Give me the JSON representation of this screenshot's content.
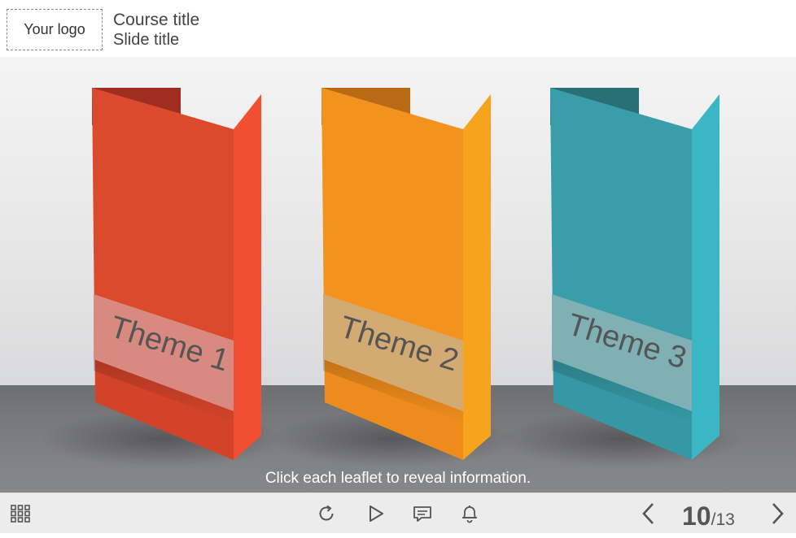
{
  "header": {
    "logo_text": "Your logo",
    "course_title": "Course title",
    "slide_title": "Slide title"
  },
  "leaflets": [
    {
      "label": "Theme 1",
      "color": "#dc4a2e"
    },
    {
      "label": "Theme 2",
      "color": "#f3931f"
    },
    {
      "label": "Theme 3",
      "color": "#3a9eaa"
    }
  ],
  "hint_text": "Click each leaflet to reveal information.",
  "toolbar": {
    "menu_icon": "grid-icon",
    "replay_icon": "replay-icon",
    "play_icon": "play-icon",
    "notes_icon": "comment-icon",
    "notification_icon": "bell-icon",
    "prev_icon": "chevron-left-icon",
    "next_icon": "chevron-right-icon",
    "current_page": "10",
    "separator": "/",
    "total_pages": "13"
  }
}
